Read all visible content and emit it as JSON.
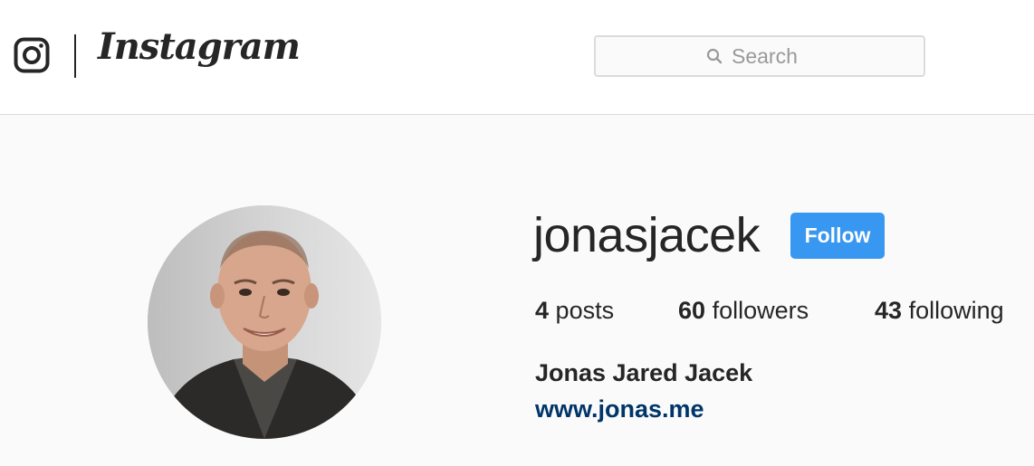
{
  "header": {
    "logo_text": "Instagram",
    "search": {
      "placeholder": "Search",
      "value": ""
    }
  },
  "profile": {
    "username": "jonasjacek",
    "follow_label": "Follow",
    "stats": {
      "posts": {
        "count": "4",
        "label": "posts"
      },
      "followers": {
        "count": "60",
        "label": "followers"
      },
      "following": {
        "count": "43",
        "label": "following"
      }
    },
    "full_name": "Jonas Jared Jacek",
    "website": "www.jonas.me"
  },
  "icons": {
    "logo": "instagram-camera-icon",
    "search": "magnifier-icon"
  },
  "colors": {
    "follow_button": "#3897f0",
    "link": "#003569",
    "text": "#262626",
    "background": "#fafafa",
    "border": "#dbdbdb"
  }
}
